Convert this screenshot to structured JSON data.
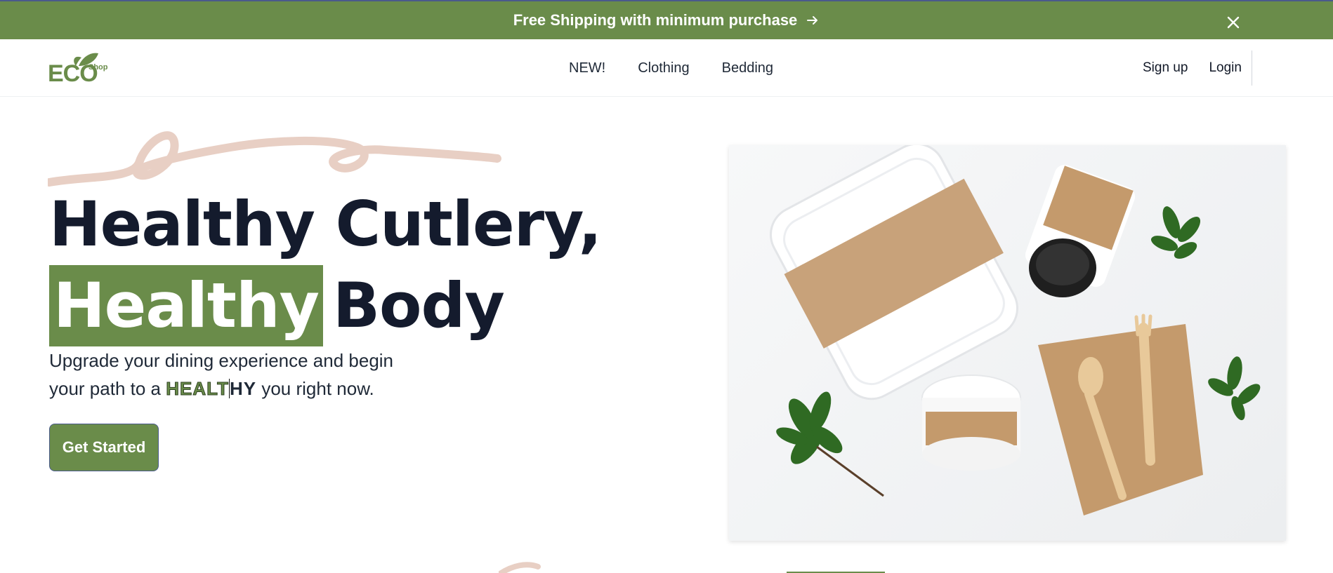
{
  "banner": {
    "message": "Free Shipping with minimum purchase",
    "arrow_icon": "arrow-right-icon",
    "close_icon": "close-icon",
    "background": "#6a8c4a"
  },
  "header": {
    "logo": {
      "main": "ECO",
      "suffix": "Shop",
      "icon": "leaf-icon"
    },
    "nav": [
      {
        "label": "NEW!"
      },
      {
        "label": "Clothing"
      },
      {
        "label": "Bedding"
      }
    ],
    "auth": {
      "signup": "Sign up",
      "login": "Login"
    }
  },
  "hero": {
    "headline_line1": "Healthy Cutlery,",
    "headline_highlight": "Healthy",
    "headline_rest": "Body",
    "subtitle_before": "Upgrade your dining experience and begin your path to a",
    "subtitle_word_green": "HEALT",
    "subtitle_word_dark": "HY",
    "subtitle_after": "you right now.",
    "cta_label": "Get Started",
    "accent_color": "#6a8c4a",
    "image_subject": "eco-friendly-tableware-photo"
  }
}
